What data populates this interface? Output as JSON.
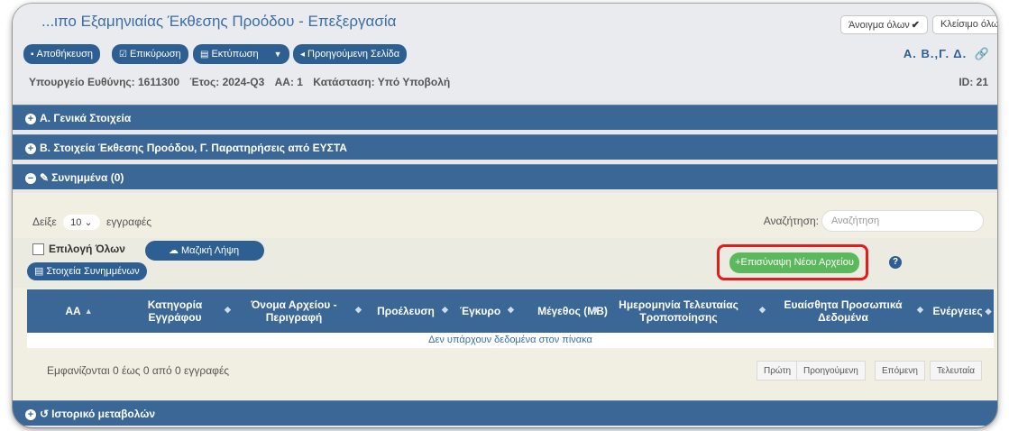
{
  "header": {
    "title": "...ιπο Εξαμηνιαίας Έκθεσης Προόδου - Επεξεργασία",
    "expand_all": "Άνοιγμα όλων",
    "close_all": "Κλείσιμο όλω"
  },
  "toolbar": {
    "save": "Αποθήκευση",
    "validate": "Επικύρωση",
    "print": "Εκτύπωση",
    "prev_page": "Προηγούμενη Σελίδα",
    "abg": "Α.  Β.,Γ.  Δ."
  },
  "meta": {
    "ministry": "Υπουργείο Ευθύνης: 1611300",
    "year": "Έτος: 2024-Q3",
    "aa": "ΑΑ: 1",
    "status": "Κατάσταση: Υπό Υποβολή",
    "id": "ID: 21"
  },
  "sections": {
    "general": "Α. Γενικά Στοιχεία",
    "report": "Β. Στοιχεία Έκθεσης Προόδου, Γ. Παρατηρήσεις από ΕΥΣΤΑ",
    "attachments": "Συνημμένα (0)",
    "history": "Ιστορικό μεταβολών"
  },
  "attachments": {
    "show_prefix": "Δείξε",
    "show_value": "10",
    "show_suffix": "εγγραφές",
    "search_label": "Αναζήτηση:",
    "search_placeholder": "Αναζήτηση",
    "select_all": "Επιλογή Όλων",
    "bulk_download": "Μαζική Λήψη",
    "attachment_info": "Στοιχεία Συνημμένων",
    "new_file": "Επισύναψη Νέου Αρχείου",
    "help": "?",
    "columns": [
      "ΑΑ",
      "Κατηγορία Εγγράφου",
      "Όνομα Αρχείου - Περιγραφή",
      "Προέλευση",
      "Έγκυρο",
      "Μέγεθος (MB)",
      "Ημερομηνία Τελευταίας Τροποποίησης",
      "Ευαίσθητα Προσωπικά Δεδομένα",
      "Ενέργειες"
    ],
    "empty": "Δεν υπάρχουν δεδομένα στον πίνακα",
    "info": "Εμφανίζονται 0 έως 0 από 0 εγγραφές",
    "pager": [
      "Πρώτη",
      "Προηγούμενη",
      "Επόμενη",
      "Τελευταία"
    ]
  },
  "colors": {
    "primary": "#2e5f93",
    "section": "#3a6795",
    "success": "#5cb85c",
    "highlight": "#e31b1b"
  }
}
